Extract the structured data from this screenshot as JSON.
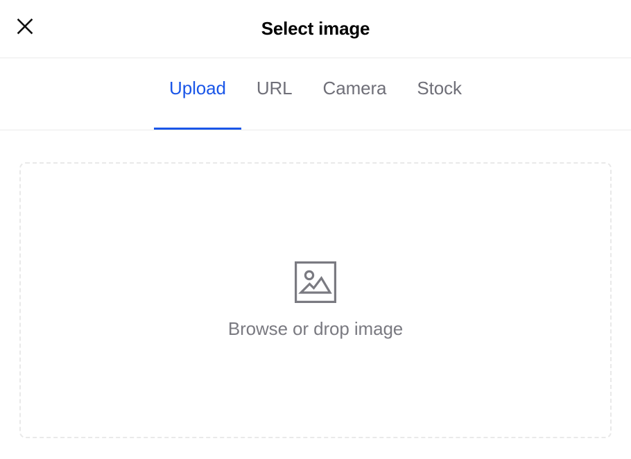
{
  "dialog": {
    "title": "Select image",
    "close_label": "Close",
    "close_icon": "close-icon",
    "accent_color": "#1a56e8",
    "inactive_color": "#6f6f78",
    "divider_color": "#ebebeb",
    "background_color": "#ffffff"
  },
  "tabs": {
    "items": [
      {
        "label": "Upload",
        "active": true
      },
      {
        "label": "URL",
        "active": false
      },
      {
        "label": "Camera",
        "active": false
      },
      {
        "label": "Stock",
        "active": false
      }
    ]
  },
  "dropzone": {
    "label": "Browse or drop image",
    "icon": "image-placeholder-icon",
    "icon_color": "#7a7a81",
    "border_color": "#e9e9e9",
    "border_style": "dashed"
  }
}
